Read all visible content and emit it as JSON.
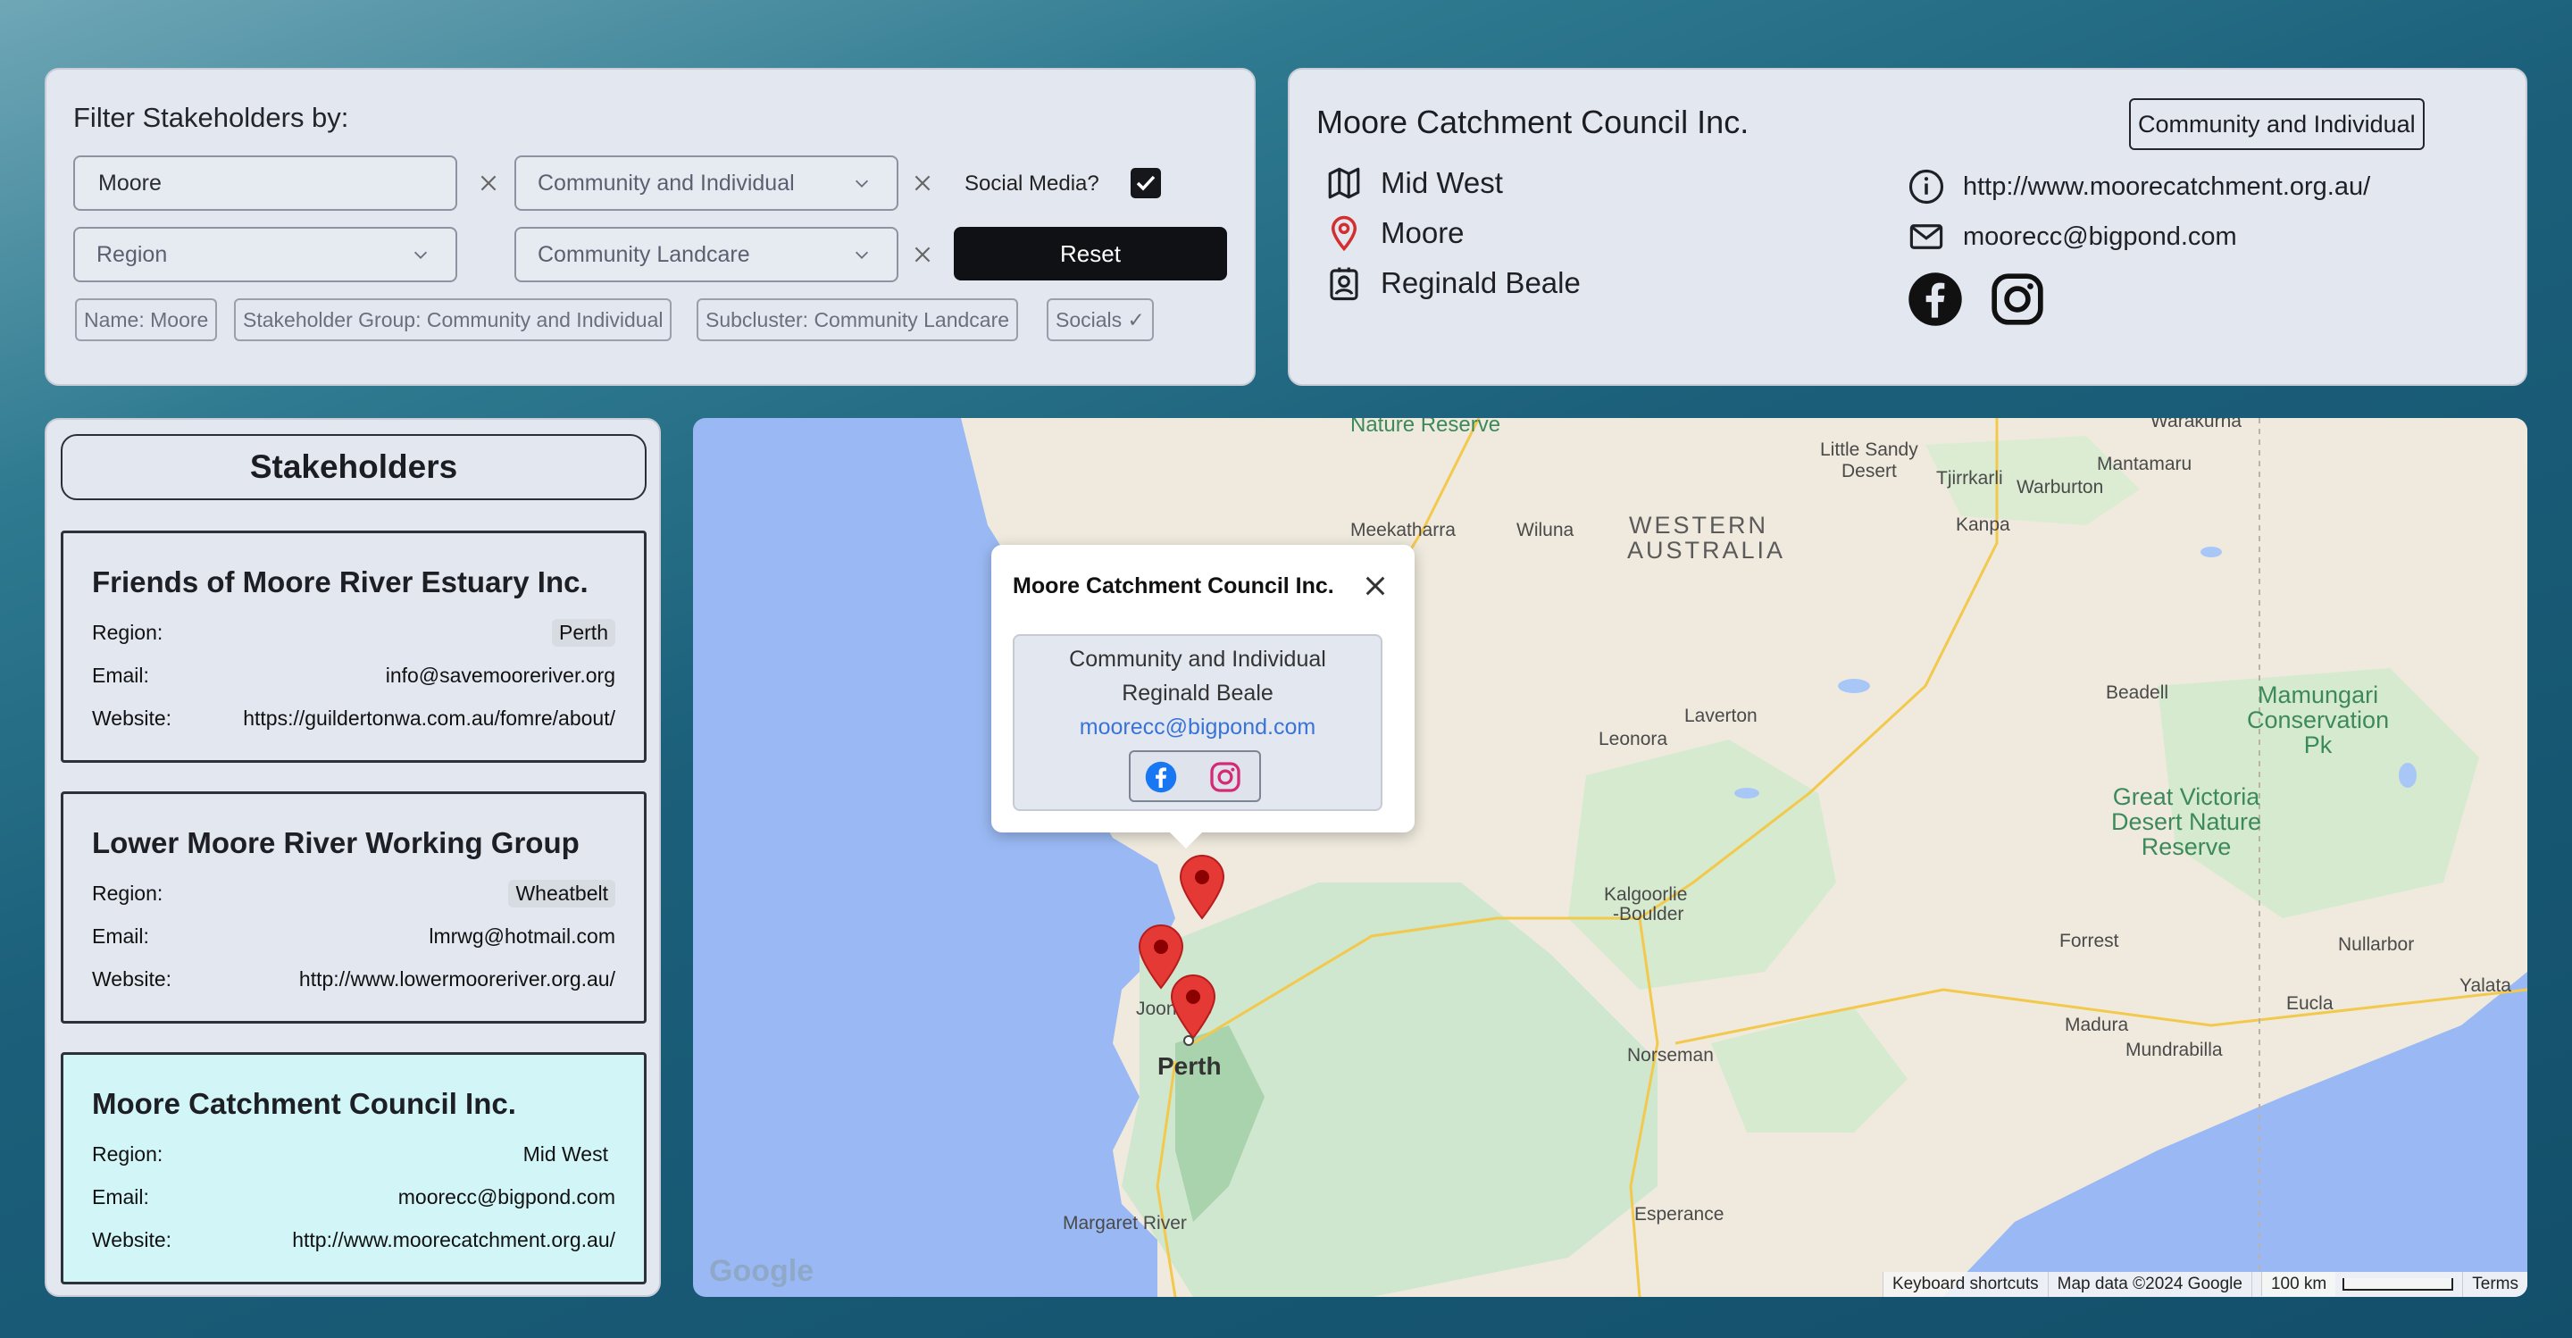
{
  "filter": {
    "title": "Filter Stakeholders by:",
    "name_value": "Moore",
    "group_value": "Community and Individual",
    "social_label": "Social Media?",
    "region_placeholder": "Region",
    "subcluster_value": "Community Landcare",
    "reset_label": "Reset",
    "social_checked": true,
    "chips": [
      "Name: Moore",
      "Stakeholder Group: Community and Individual",
      "Subcluster: Community Landcare",
      "Socials ✓"
    ]
  },
  "detail": {
    "name": "Moore Catchment Council Inc.",
    "group": "Community and Individual",
    "region": "Mid West",
    "location": "Moore",
    "contact": "Reginald Beale",
    "website": "http://www.moorecatchment.org.au/",
    "email": "moorecc@bigpond.com"
  },
  "list": {
    "title": "Stakeholders",
    "labels": {
      "region": "Region:",
      "email": "Email:",
      "website": "Website:"
    },
    "items": [
      {
        "name": "Friends of Moore River Estuary Inc.",
        "region": "Perth",
        "email": "info@savemooreriver.org",
        "website": "https://guildertonwa.com.au/fomre/about/"
      },
      {
        "name": "Lower Moore River Working Group",
        "region": "Wheatbelt",
        "email": "lmrwg@hotmail.com",
        "website": "http://www.lowermooreriver.org.au/"
      },
      {
        "name": "Moore Catchment Council Inc.",
        "region": "Mid West",
        "email": "moorecc@bigpond.com",
        "website": "http://www.moorecatchment.org.au/"
      }
    ]
  },
  "map": {
    "popup": {
      "title": "Moore Catchment Council Inc.",
      "group": "Community and Individual",
      "contact": "Reginald Beale",
      "email": "moorecc@bigpond.com"
    },
    "labels": {
      "meekatharra": "Meekatharra",
      "wiluna": "Wiluna",
      "wa1": "WESTERN",
      "wa2": "AUSTRALIA",
      "little_sandy_1": "Little Sandy",
      "little_sandy_2": "Desert",
      "tjirrkarli": "Tjirrkarli",
      "warburton": "Warburton",
      "mantamaru": "Mantamaru",
      "kanpa": "Kanpa",
      "laverton": "Laverton",
      "leonora": "Leonora",
      "beadell": "Beadell",
      "mamungari_1": "Mamungari",
      "mamungari_2": "Conservation",
      "mamungari_3": "Pk",
      "gvd_1": "Great Victoria",
      "gvd_2": "Desert Nature",
      "gvd_3": "Reserve",
      "kalgoorlie_1": "Kalgoorlie",
      "kalgoorlie_2": "-Boulder",
      "forrest": "Forrest",
      "nullarbor": "Nullarbor",
      "yalata": "Yalata",
      "eucla": "Eucla",
      "madura": "Madura",
      "mundrabilla": "Mundrabilla",
      "joondalup_a": "Joon",
      "joondalup_b": "up",
      "perth": "Perth",
      "norseman": "Norseman",
      "esperance": "Esperance",
      "margaret_river": "Margaret River",
      "nature_reserve": "Nature Reserve",
      "warakurna": "Warakurna"
    },
    "footer": {
      "shortcuts": "Keyboard shortcuts",
      "mapdata": "Map data ©2024 Google",
      "scale": "100 km",
      "terms": "Terms"
    },
    "logo": "Google"
  },
  "colors": {
    "accent_dark": "#0f1115",
    "selected_card": "#d2f6f8",
    "marker": "#e53935",
    "link": "#3a73d8"
  }
}
